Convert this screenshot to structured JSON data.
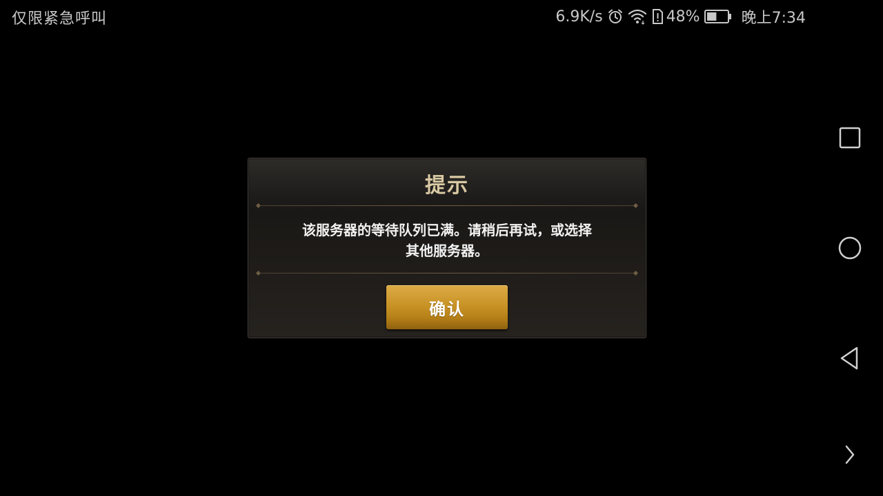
{
  "status_bar": {
    "carrier_text": "仅限紧急呼叫",
    "net_speed": "6.9K/s",
    "battery_percent": "48%",
    "battery_level": 0.48,
    "time": "晚上7:34",
    "icons": [
      "alarm-icon",
      "wifi-icon",
      "sim-alert-icon",
      "battery-icon"
    ]
  },
  "dialog": {
    "title": "提示",
    "message_line1": "该服务器的等待队列已满。请稍后再试，或选择",
    "message_line2": "其他服务器。",
    "confirm_label": "确认"
  },
  "nav_bar": {
    "icons": [
      "recent-apps-icon",
      "home-icon",
      "back-icon",
      "expand-icon"
    ]
  },
  "colors": {
    "background": "#000000",
    "title_gold": "#d9c9a3",
    "button_gold": "#c99326",
    "status_text": "#c8c8c8"
  }
}
